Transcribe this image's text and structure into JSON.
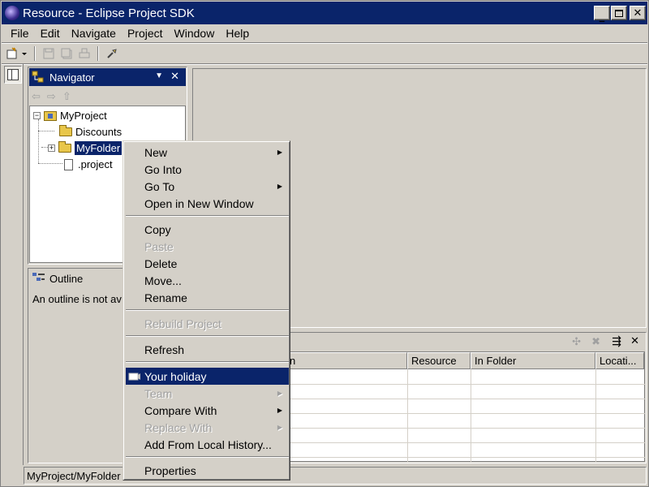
{
  "window": {
    "title": "Resource - Eclipse Project SDK"
  },
  "menubar": [
    "File",
    "Edit",
    "Navigate",
    "Project",
    "Window",
    "Help"
  ],
  "navigator": {
    "title": "Navigator",
    "tree": {
      "project": "MyProject",
      "items": [
        "Discounts",
        "MyFolder",
        ".project"
      ]
    }
  },
  "outline": {
    "title": "Outline",
    "message": "An outline is not av"
  },
  "tasks": {
    "columns": [
      "n",
      "Resource",
      "In Folder",
      "Locati..."
    ]
  },
  "context_menu": {
    "items": [
      {
        "label": "New",
        "submenu": true,
        "enabled": true
      },
      {
        "label": "Go Into",
        "submenu": false,
        "enabled": true
      },
      {
        "label": "Go To",
        "submenu": true,
        "enabled": true
      },
      {
        "label": "Open in New Window",
        "submenu": false,
        "enabled": true
      },
      {
        "label": "Copy",
        "submenu": false,
        "enabled": true
      },
      {
        "label": "Paste",
        "submenu": false,
        "enabled": false
      },
      {
        "label": "Delete",
        "submenu": false,
        "enabled": true
      },
      {
        "label": "Move...",
        "submenu": false,
        "enabled": true
      },
      {
        "label": "Rename",
        "submenu": false,
        "enabled": true
      },
      {
        "label": "Rebuild Project",
        "submenu": false,
        "enabled": false
      },
      {
        "label": "Refresh",
        "submenu": false,
        "enabled": true
      },
      {
        "label": "Your holiday",
        "submenu": false,
        "enabled": true,
        "highlighted": true
      },
      {
        "label": "Team",
        "submenu": true,
        "enabled": false
      },
      {
        "label": "Compare With",
        "submenu": true,
        "enabled": true
      },
      {
        "label": "Replace With",
        "submenu": true,
        "enabled": false
      },
      {
        "label": "Add From Local History...",
        "submenu": false,
        "enabled": true
      },
      {
        "label": "Properties",
        "submenu": false,
        "enabled": true
      }
    ]
  },
  "statusbar": {
    "text": "MyProject/MyFolder"
  }
}
